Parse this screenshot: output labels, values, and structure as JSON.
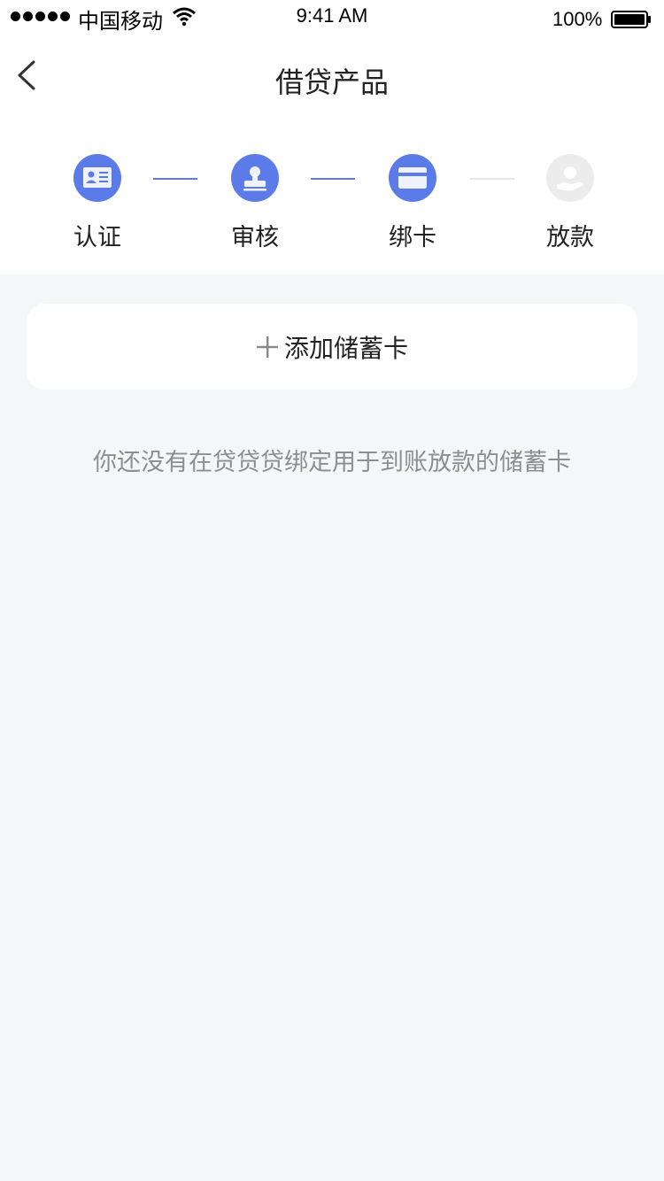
{
  "status_bar": {
    "carrier": "中国移动",
    "time": "9:41 AM",
    "battery": "100%"
  },
  "nav": {
    "title": "借贷产品"
  },
  "steps": [
    {
      "label": "认证",
      "icon": "id-card-icon",
      "state": "active"
    },
    {
      "label": "审核",
      "icon": "stamp-icon",
      "state": "active"
    },
    {
      "label": "绑卡",
      "icon": "bank-card-icon",
      "state": "active"
    },
    {
      "label": "放款",
      "icon": "hand-coin-icon",
      "state": "inactive"
    }
  ],
  "add_card": {
    "label": "添加储蓄卡"
  },
  "hint": "你还没有在贷贷贷绑定用于到账放款的储蓄卡",
  "colors": {
    "accent": "#5b7be8",
    "inactive": "#ececec",
    "background": "#f5f6f8"
  }
}
